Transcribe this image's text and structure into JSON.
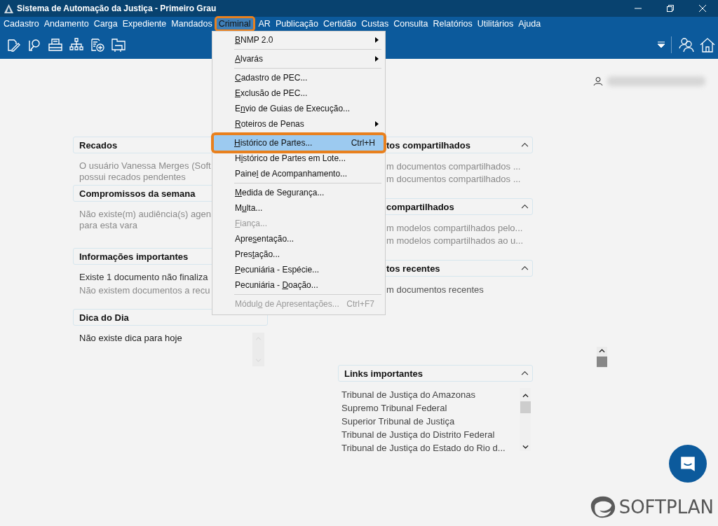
{
  "window": {
    "title": "Sistema de Automação da Justiça - Primeiro Grau"
  },
  "menu_bar": [
    {
      "label": "Cadastro",
      "selected": false
    },
    {
      "label": "Andamento",
      "selected": false
    },
    {
      "label": "Carga",
      "selected": false
    },
    {
      "label": "Expediente",
      "selected": false
    },
    {
      "label": "Mandados",
      "selected": false
    },
    {
      "label": "Criminal",
      "selected": true
    },
    {
      "label": "AR",
      "selected": false
    },
    {
      "label": "Publicação",
      "selected": false
    },
    {
      "label": "Certidão",
      "selected": false
    },
    {
      "label": "Custas",
      "selected": false
    },
    {
      "label": "Consulta",
      "selected": false
    },
    {
      "label": "Relatórios",
      "selected": false
    },
    {
      "label": "Utilitários",
      "selected": false
    },
    {
      "label": "Ajuda",
      "selected": false
    }
  ],
  "dropdown": [
    {
      "kind": "item",
      "label": {
        "key": "B",
        "post": "NMP 2.0"
      },
      "submenu": true,
      "disabled": false,
      "selected": false
    },
    {
      "kind": "separator"
    },
    {
      "kind": "item",
      "label": {
        "key": "A",
        "post": "lvarás"
      },
      "submenu": true,
      "disabled": false,
      "selected": false
    },
    {
      "kind": "separator"
    },
    {
      "kind": "item",
      "label": {
        "key": "C",
        "post": "adastro de PEC..."
      },
      "submenu": false,
      "disabled": false,
      "selected": false
    },
    {
      "kind": "item",
      "label": {
        "key": "E",
        "post": "xclusão de PEC..."
      },
      "submenu": false,
      "disabled": false,
      "selected": false
    },
    {
      "kind": "item",
      "label": {
        "pre": "E",
        "key": "n",
        "post": "vio de Guias de Execução..."
      },
      "submenu": false,
      "disabled": false,
      "selected": false
    },
    {
      "kind": "item",
      "label": {
        "key": "R",
        "post": "oteiros de Penas"
      },
      "submenu": true,
      "disabled": false,
      "selected": false
    },
    {
      "kind": "separator"
    },
    {
      "kind": "item",
      "label": {
        "key": "H",
        "post": "istórico de Partes..."
      },
      "shortcut": "Ctrl+H",
      "submenu": false,
      "disabled": false,
      "selected": true
    },
    {
      "kind": "item",
      "label": {
        "pre": "H",
        "key": "i",
        "post": "stórico de Partes em Lote..."
      },
      "submenu": false,
      "disabled": false,
      "selected": false
    },
    {
      "kind": "item",
      "label": {
        "pre": "Paine",
        "key": "l",
        "post": " de Acompanhamento..."
      },
      "submenu": false,
      "disabled": false,
      "selected": false
    },
    {
      "kind": "separator"
    },
    {
      "kind": "item",
      "label": {
        "key": "M",
        "post": "edida de Segurança..."
      },
      "submenu": false,
      "disabled": false,
      "selected": false
    },
    {
      "kind": "item",
      "label": {
        "pre": "M",
        "key": "u",
        "post": "lta..."
      },
      "submenu": false,
      "disabled": false,
      "selected": false
    },
    {
      "kind": "item",
      "label": {
        "key": "F",
        "post": "iança..."
      },
      "submenu": false,
      "disabled": true,
      "selected": false
    },
    {
      "kind": "item",
      "label": {
        "pre": "Apre",
        "key": "s",
        "post": "entação..."
      },
      "submenu": false,
      "disabled": false,
      "selected": false
    },
    {
      "kind": "item",
      "label": {
        "pre": "Pres",
        "key": "t",
        "post": "ação..."
      },
      "submenu": false,
      "disabled": false,
      "selected": false
    },
    {
      "kind": "item",
      "label": {
        "key": "P",
        "post": "ecuniária - Espécie..."
      },
      "submenu": false,
      "disabled": false,
      "selected": false
    },
    {
      "kind": "item",
      "label": {
        "pre": "Pecuniária - ",
        "key": "D",
        "post": "oação..."
      },
      "submenu": false,
      "disabled": false,
      "selected": false
    },
    {
      "kind": "separator"
    },
    {
      "kind": "item",
      "label": {
        "pre": "Módul",
        "key": "o",
        "post": " de Apresentações..."
      },
      "shortcut": "Ctrl+F7",
      "submenu": false,
      "disabled": true,
      "selected": false
    }
  ],
  "left_panels": [
    {
      "title": "Recados",
      "lines": [
        {
          "text": "O usuário Vanessa Merges (Soft",
          "muted": true
        },
        {
          "text": "possui recados pendentes",
          "muted": true
        }
      ]
    },
    {
      "title": "Compromissos da semana",
      "lines": [
        {
          "text": "Não existe(m) audiência(s) agen",
          "muted": true
        },
        {
          "text": "para esta vara",
          "muted": true
        }
      ]
    },
    {
      "title": "Informações importantes",
      "lines": [
        {
          "text": "Existe 1 documento não finaliza",
          "muted": false
        },
        {
          "text": "Não existem documentos a recu",
          "muted": true
        }
      ]
    },
    {
      "title": "Dica do Dia",
      "lines": [
        {
          "text": "Não existe dica para hoje",
          "muted": false
        }
      ]
    }
  ],
  "right_panels": [
    {
      "title": "tos compartilhados",
      "lines": [
        {
          "text": "m documentos compartilhados ...",
          "muted": true
        },
        {
          "text": "m documentos compartilhados ...",
          "muted": true
        }
      ]
    },
    {
      "title": "compartilhados",
      "lines": [
        {
          "text": "m modelos compartilhados pelo...",
          "muted": true
        },
        {
          "text": "m modelos compartilhados ao u...",
          "muted": true
        }
      ]
    },
    {
      "title": "tos recentes",
      "lines": [
        {
          "text": "m documentos recentes",
          "muted": false
        }
      ]
    }
  ],
  "links_panel": {
    "title": "Links importantes",
    "links": [
      "Tribunal de Justiça do Amazonas",
      "Supremo Tribunal Federal",
      "Superior Tribunal de Justiça",
      "Tribunal de Justiça do Distrito Federal",
      "Tribunal de Justiça do Estado do Rio d..."
    ]
  },
  "brand": "SOFTPLAN"
}
